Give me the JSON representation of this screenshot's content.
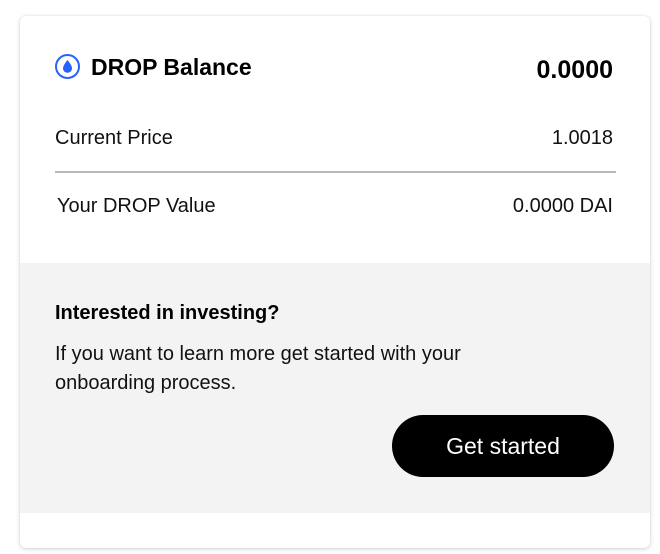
{
  "balance": {
    "title": "DROP Balance",
    "value": "0.0000",
    "icon": "drop-token-icon",
    "icon_color": "#2762ff"
  },
  "stats": {
    "current_price_label": "Current Price",
    "current_price_value": "1.0018",
    "drop_value_label": "Your DROP Value",
    "drop_value_value": "0.0000 DAI"
  },
  "invest": {
    "heading": "Interested in investing?",
    "text": "If you want to learn more get started with your onboarding process.",
    "button_label": "Get started",
    "panel_color": "#f3f3f3",
    "button_color": "#000000"
  }
}
